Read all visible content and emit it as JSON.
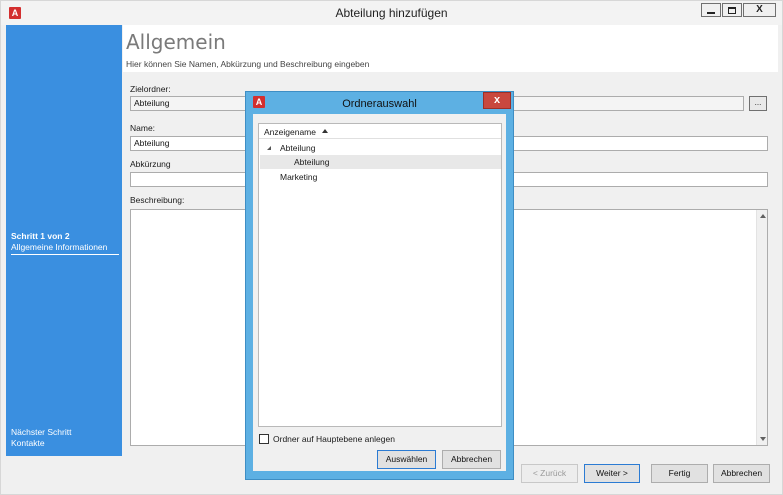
{
  "window": {
    "title": "Abteilung hinzufügen",
    "app_icon_letter": "A",
    "close_glyph": "X"
  },
  "sidebar": {
    "step_label": "Schritt 1 von 2",
    "step_current": "Allgemeine Informationen",
    "next_label": "Nächster Schritt",
    "next_value": "Kontakte"
  },
  "main": {
    "title": "Allgemein",
    "subtitle": "Hier können Sie Namen, Abkürzung und Beschreibung eingeben",
    "fields": {
      "target_folder_label": "Zielordner:",
      "target_folder_value": "Abteilung",
      "browse_label": "...",
      "name_label": "Name:",
      "name_value": "Abteilung",
      "abbrev_label": "Abkürzung",
      "abbrev_value": "",
      "description_label": "Beschreibung:",
      "description_value": ""
    }
  },
  "footer": {
    "back_label": "< Zurück",
    "next_label": "Weiter >",
    "finish_label": "Fertig",
    "cancel_label": "Abbrechen"
  },
  "modal": {
    "title": "Ordnerauswahl",
    "icon_letter": "A",
    "close_glyph": "x",
    "column_header": "Anzeigename",
    "tree": [
      {
        "label": "Abteilung",
        "level": 0,
        "expanded": true
      },
      {
        "label": "Abteilung",
        "level": 1,
        "selected": true
      },
      {
        "label": "Marketing",
        "level": 0
      }
    ],
    "checkbox_label": "Ordner auf Hauptebene anlegen",
    "checkbox_checked": false,
    "select_label": "Auswählen",
    "cancel_label": "Abbrechen"
  }
}
